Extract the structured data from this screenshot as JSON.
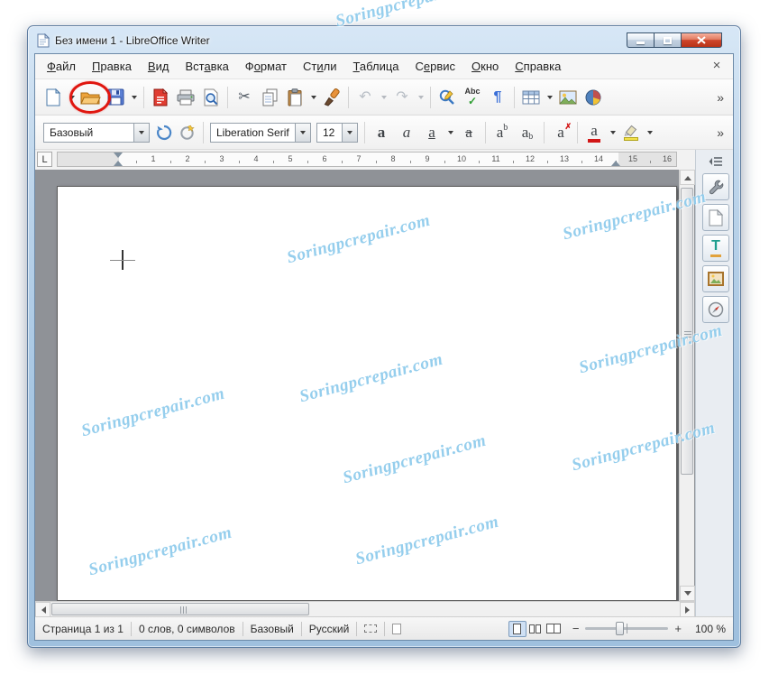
{
  "window": {
    "title": "Без имени 1 - LibreOffice Writer"
  },
  "watermark": {
    "text": "Soringpcrepair.com"
  },
  "menu": {
    "items": [
      {
        "name": "file",
        "label": "Файл",
        "u": 0
      },
      {
        "name": "edit",
        "label": "Правка",
        "u": 0
      },
      {
        "name": "view",
        "label": "Вид",
        "u": 0
      },
      {
        "name": "insert",
        "label": "Вставка",
        "u": 3
      },
      {
        "name": "format",
        "label": "Формат",
        "u": 1
      },
      {
        "name": "styles",
        "label": "Стили",
        "u": 2
      },
      {
        "name": "table",
        "label": "Таблица",
        "u": 0
      },
      {
        "name": "tools",
        "label": "Сервис",
        "u": 1
      },
      {
        "name": "window",
        "label": "Окно",
        "u": 0
      },
      {
        "name": "help",
        "label": "Справка",
        "u": 0
      }
    ],
    "close_glyph": "×"
  },
  "toolbar": {
    "icons": {
      "cut": "✂",
      "undo": "↶",
      "redo": "↷",
      "spelling": "Abc",
      "spelling_check": "✓",
      "formatting_marks": "¶"
    },
    "overflow": "»"
  },
  "formatting": {
    "style_value": "Базовый",
    "font_value": "Liberation Serif",
    "size_value": "12",
    "glyphs": {
      "bold": "а",
      "italic": "а",
      "underline": "а",
      "strikethrough": "а",
      "sup_base": "а",
      "sup_mark": "b",
      "sub_base": "а",
      "sub_mark": "b",
      "clear": "а",
      "clear_mark": "✗",
      "font_color": "а"
    },
    "overflow": "»"
  },
  "ruler": {
    "tab_selector": "L",
    "numbers": [
      "1",
      "2",
      "3",
      "4",
      "5",
      "6",
      "7",
      "8",
      "9",
      "10",
      "11",
      "12",
      "13",
      "14",
      "15",
      "16"
    ]
  },
  "statusbar": {
    "page": "Страница 1 из 1",
    "words": "0 слов, 0 символов",
    "style": "Базовый",
    "language": "Русский",
    "zoom_out": "−",
    "zoom_in": "+",
    "zoom_value": "100 %"
  }
}
